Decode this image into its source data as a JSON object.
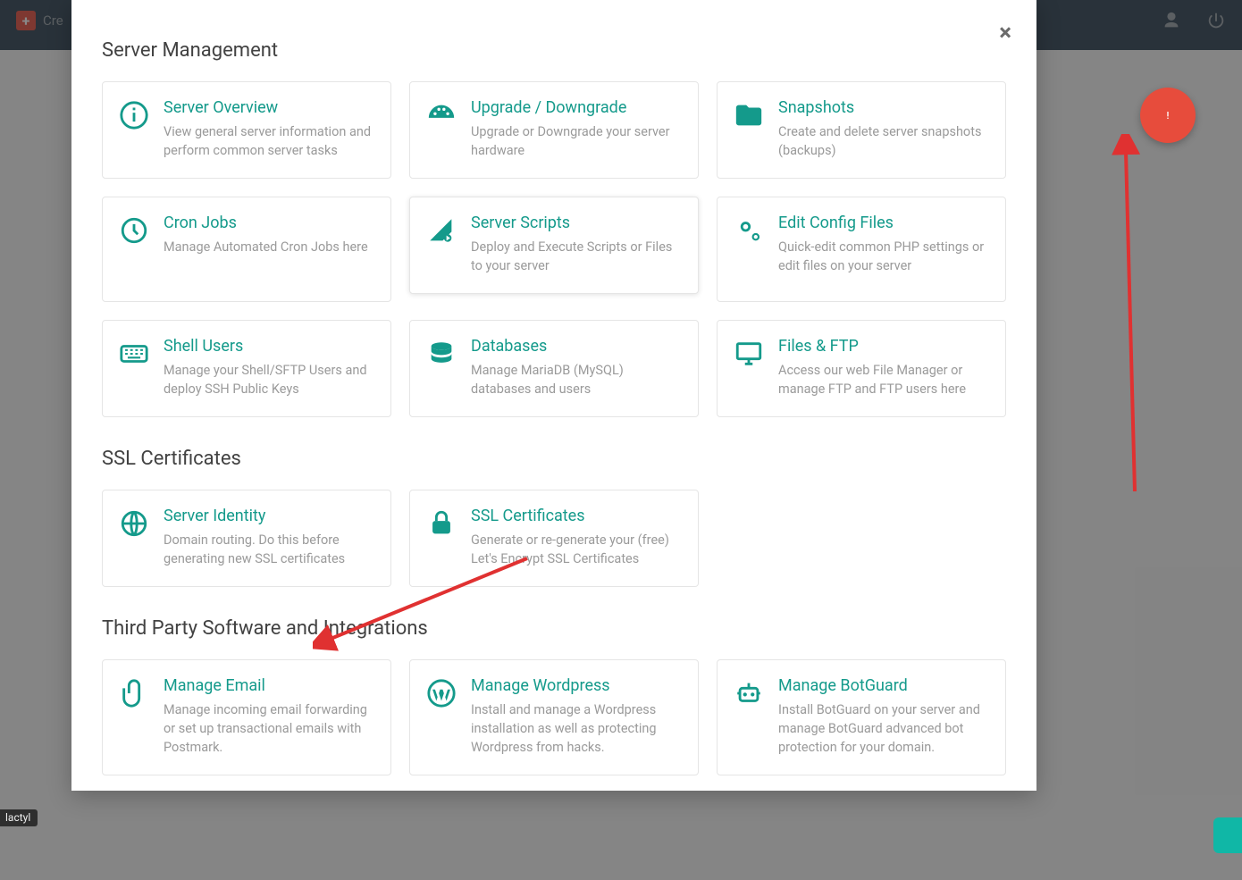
{
  "background": {
    "create_label": "Cre",
    "tag_label": "lactyl"
  },
  "modal": {
    "sections": [
      {
        "title": "Server Management",
        "cards": [
          {
            "icon": "info",
            "title": "Server Overview",
            "desc": "View general server information and perform common server tasks"
          },
          {
            "icon": "gauge",
            "title": "Upgrade / Downgrade",
            "desc": "Upgrade or Downgrade your server hardware"
          },
          {
            "icon": "folder",
            "title": "Snapshots",
            "desc": "Create and delete server snapshots (backups)"
          },
          {
            "icon": "clock",
            "title": "Cron Jobs",
            "desc": "Manage Automated Cron Jobs here"
          },
          {
            "icon": "script",
            "title": "Server Scripts",
            "desc": "Deploy and Execute Scripts or Files to your server",
            "highlight": true
          },
          {
            "icon": "gears",
            "title": "Edit Config Files",
            "desc": "Quick-edit common PHP settings or edit files on your server"
          },
          {
            "icon": "keyboard",
            "title": "Shell Users",
            "desc": "Manage your Shell/SFTP Users and deploy SSH Public Keys"
          },
          {
            "icon": "database",
            "title": "Databases",
            "desc": "Manage MariaDB (MySQL) databases and users"
          },
          {
            "icon": "monitor",
            "title": "Files & FTP",
            "desc": "Access our web File Manager or manage FTP and FTP users here"
          }
        ]
      },
      {
        "title": "SSL Certificates",
        "cards": [
          {
            "icon": "globe",
            "title": "Server Identity",
            "desc": "Domain routing. Do this before generating new SSL certificates"
          },
          {
            "icon": "lock",
            "title": "SSL Certificates",
            "desc": "Generate or re-generate your (free) Let's Encrypt SSL Certificates"
          }
        ]
      },
      {
        "title": "Third Party Software and Integrations",
        "cards": [
          {
            "icon": "clip",
            "title": "Manage Email",
            "desc": "Manage incoming email forwarding or set up transactional emails with Postmark."
          },
          {
            "icon": "wordpress",
            "title": "Manage Wordpress",
            "desc": "Install and manage a Wordpress installation as well as protecting Wordpress from hacks."
          },
          {
            "icon": "robot",
            "title": "Manage BotGuard",
            "desc": "Install BotGuard on your server and manage BotGuard advanced bot protection for your domain."
          }
        ]
      }
    ]
  }
}
